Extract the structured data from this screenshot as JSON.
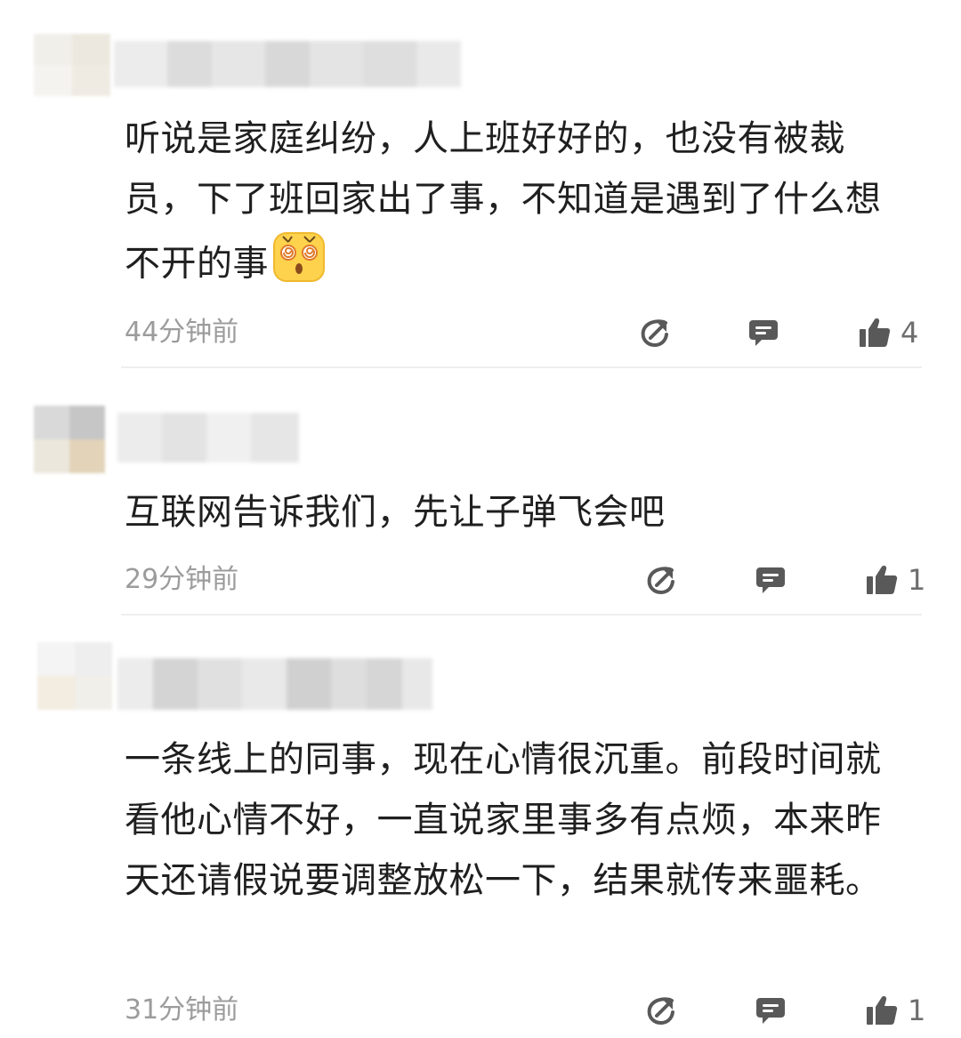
{
  "comments": [
    {
      "text": "听说是家庭纠纷，人上班好好的，也没有被裁员，下了班回家出了事，不知道是遇到了什么想不开的事",
      "emoji": "dizzy-face-emoji",
      "time": "44分钟前",
      "likes": "4"
    },
    {
      "text": "互联网告诉我们，先让子弹飞会吧",
      "time": "29分钟前",
      "likes": "1"
    },
    {
      "text": "一条线上的同事，现在心情很沉重。前段时间就看他心情不好，一直说家里事多有点烦，本来昨天还请假说要调整放松一下，结果就传来噩耗。",
      "time": "31分钟前",
      "likes": "1"
    }
  ],
  "icons": {
    "share": "share-arrow-icon",
    "reply": "comment-bubble-icon",
    "like": "thumbs-up-icon"
  },
  "colors": {
    "icon": "#595959",
    "time": "#9c9c9c",
    "text": "#1f1f1f",
    "emoji": "#ffd24d"
  }
}
